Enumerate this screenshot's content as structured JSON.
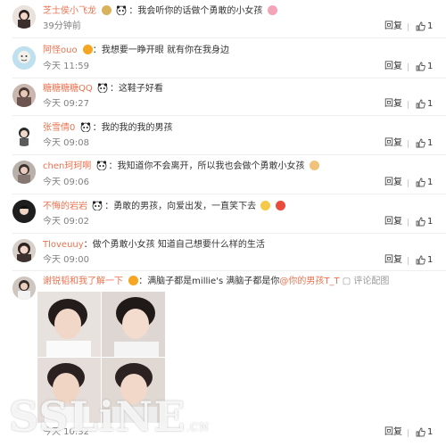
{
  "comments": [
    {
      "user": "芝士侯小飞龙",
      "text": "我会听你的话做个勇敢的小女孩",
      "time": "39分钟前",
      "reply": "回复",
      "likes": "1"
    },
    {
      "user": "阿怪ouo",
      "text": "我想要一睁开眼 就有你在我身边",
      "time": "今天 11:59",
      "reply": "回复",
      "likes": "1"
    },
    {
      "user": "糖糖糖糖QQ",
      "text": "这鞋子好看",
      "time": "今天 09:27",
      "reply": "回复",
      "likes": "1"
    },
    {
      "user": "张雪倩0",
      "text": "我的我的我的男孩",
      "time": "今天 09:08",
      "reply": "回复",
      "likes": "1"
    },
    {
      "user": "chen珂珂啊",
      "text": "我知道你不会离开，所以我也会做个勇敢小女孩",
      "time": "今天 09:06",
      "reply": "回复",
      "likes": "1"
    },
    {
      "user": "不悔的岩岩",
      "text": "勇敢的男孩，向爱出发，一直笑下去",
      "time": "今天 09:02",
      "reply": "回复",
      "likes": "1"
    },
    {
      "user": "Tloveuuy",
      "text": "做个勇敢小女孩 知道自己想要什么样的生活",
      "time": "今天 09:00",
      "reply": "回复",
      "likes": "1"
    },
    {
      "user": "谢锐韬和我了解一下",
      "text_before": "满脑子都是millie's  满脑子都是你",
      "mention": "@你的男孩T_T",
      "report_label": "评论配图",
      "time": "今天 10:32",
      "reply": "回复",
      "likes": "1"
    }
  ],
  "text_separator": "：",
  "watermark": "SSLiNE",
  "watermark_suffix": ".CN",
  "colors": {
    "username": "#eb7350",
    "time": "#808080",
    "badge_gold": "#f5a623",
    "badge_red": "#e94c3d"
  }
}
